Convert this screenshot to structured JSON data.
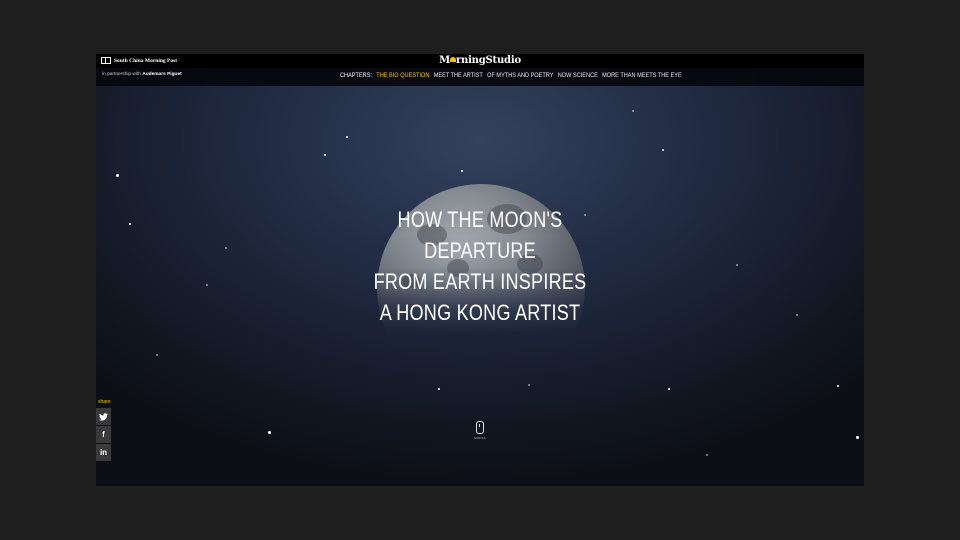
{
  "header": {
    "brand_name": "South China Morning Post",
    "logo_prefix": "M",
    "logo_suffix": "rningStudio",
    "partner_prefix": "in partnership with",
    "partner_name": "Audemars Piguet"
  },
  "nav": {
    "label": "CHAPTERS:",
    "items": [
      {
        "label": "THE BIG QUESTION",
        "active": true
      },
      {
        "label": "MEET THE ARTIST",
        "active": false
      },
      {
        "label": "OF MYTHS AND POETRY",
        "active": false
      },
      {
        "label": "NOW SCIENCE",
        "active": false
      },
      {
        "label": "MORE THAN MEETS THE EYE",
        "active": false
      }
    ]
  },
  "hero": {
    "headline_lines": [
      "HOW THE MOON'S",
      "DEPARTURE",
      "FROM EARTH INSPIRES",
      "A HONG KONG ARTIST"
    ]
  },
  "share": {
    "label": "share",
    "buttons": [
      {
        "icon": "twitter-icon",
        "glyph": "🐦"
      },
      {
        "icon": "facebook-icon",
        "glyph": "f"
      },
      {
        "icon": "linkedin-icon",
        "glyph": "in"
      }
    ]
  },
  "scroll": {
    "label": "SCROLL"
  },
  "colors": {
    "accent": "#f5c400",
    "topbar": "#000000",
    "share_button": "#3a3a3a"
  }
}
